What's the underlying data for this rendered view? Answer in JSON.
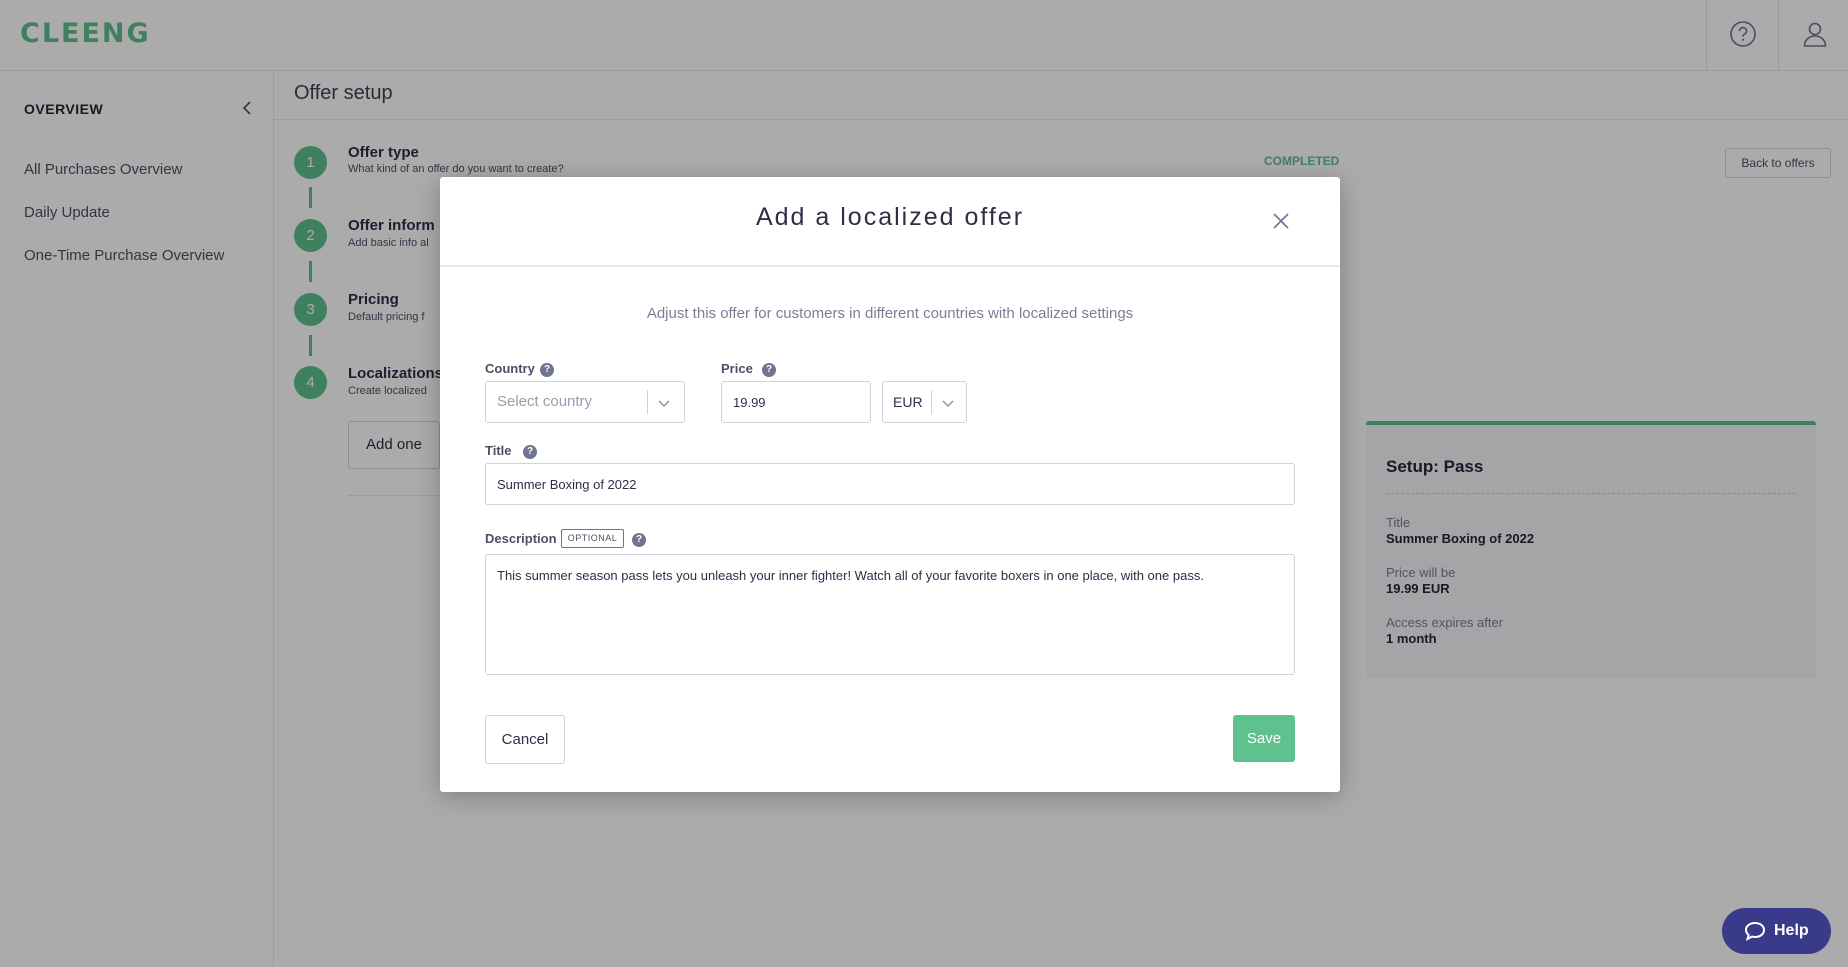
{
  "app": {
    "logo": "CLEENG"
  },
  "sidebar": {
    "heading": "OVERVIEW",
    "items": [
      "All Purchases Overview",
      "Daily Update",
      "One-Time Purchase Overview"
    ]
  },
  "main": {
    "title": "Offer setup",
    "steps": [
      {
        "num": "1",
        "title": "Offer type",
        "desc": "What kind of an offer do you want to create?"
      },
      {
        "num": "2",
        "title": "Offer inform",
        "desc": "Add basic info al"
      },
      {
        "num": "3",
        "title": "Pricing",
        "desc": "Default pricing f"
      },
      {
        "num": "4",
        "title": "Localizations",
        "desc": "Create localized"
      }
    ],
    "completed_label": "COMPLETED",
    "back_button": "Back to offers",
    "add_one_button": "Add one"
  },
  "summary": {
    "title": "Setup: Pass",
    "rows": [
      {
        "label": "Title",
        "value": "Summer Boxing of 2022"
      },
      {
        "label": "Price will be",
        "value": "19.99 EUR"
      },
      {
        "label": "Access expires after",
        "value": "1 month"
      }
    ]
  },
  "modal": {
    "title": "Add a localized offer",
    "subtitle": "Adjust this offer for customers in different countries with localized settings",
    "country": {
      "label": "Country",
      "placeholder": "Select country"
    },
    "price": {
      "label": "Price",
      "value": "19.99",
      "currency": "EUR"
    },
    "title_field": {
      "label": "Title",
      "value": "Summer Boxing of 2022"
    },
    "description": {
      "label": "Description",
      "badge": "OPTIONAL",
      "value": "This summer season pass lets you unleash your inner fighter! Watch all of your favorite boxers in one place, with one pass."
    },
    "cancel": "Cancel",
    "save": "Save",
    "help_icon_glyph": "?"
  },
  "help_widget": {
    "label": "Help"
  },
  "icons": [
    "question-circle-icon",
    "user-icon",
    "chevron-left-icon",
    "close-icon",
    "chevron-down-icon",
    "chat-bubble-icon"
  ],
  "colors": {
    "accent": "#5fc18e",
    "help_button": "#3a3a8a",
    "overlay": "rgba(0,0,0,0.33)"
  }
}
